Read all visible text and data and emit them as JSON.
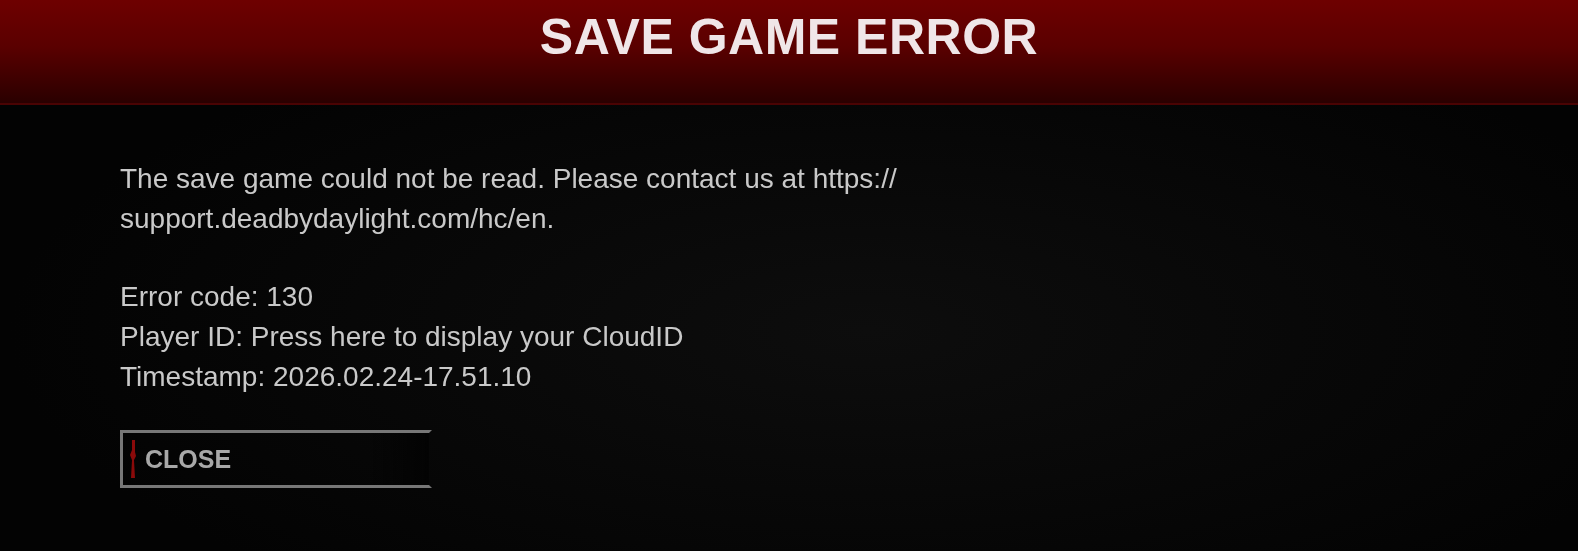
{
  "header": {
    "title": "SAVE GAME ERROR"
  },
  "message_lines": [
    "The save game could not be read. Please contact us at https://",
    "support.deadbydaylight.com/hc/en."
  ],
  "details": [
    "Error code: 130",
    "Player ID: Press here to display your CloudID",
    "Timestamp: 2026.02.24-17.51.10"
  ],
  "buttons": [
    {
      "label": "CLOSE"
    }
  ]
}
